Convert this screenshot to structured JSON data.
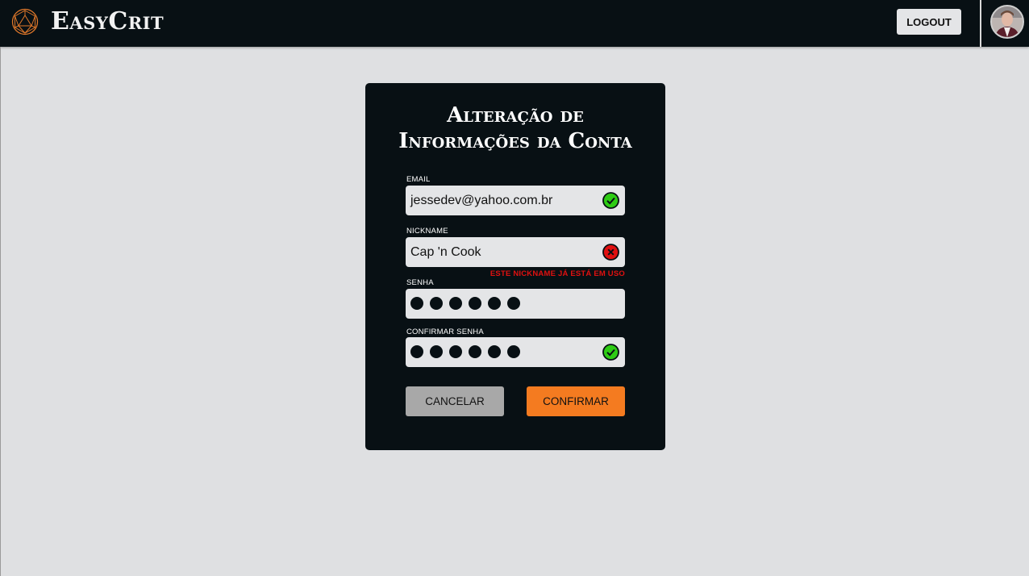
{
  "header": {
    "brand": "EasyCrit",
    "logout_label": "LOGOUT",
    "logo_icon": "d20-icon",
    "avatar_icon": "user-avatar"
  },
  "form": {
    "title_line1": "Alteração de",
    "title_line2": "Informações da Conta",
    "email": {
      "label": "EMAIL",
      "value": "jessedev@yahoo.com.br",
      "status": "valid"
    },
    "nickname": {
      "label": "NICKNAME",
      "value": "Cap 'n Cook",
      "status": "invalid",
      "error": "ESTE NICKNAME JÁ ESTÁ EM USO"
    },
    "password": {
      "label": "SENHA",
      "masked_length": 6
    },
    "confirm_password": {
      "label": "CONFIRMAR SENHA",
      "masked_length": 6,
      "status": "valid"
    },
    "cancel_label": "CANCELAR",
    "confirm_label": "CONFIRMAR"
  },
  "colors": {
    "background": "#dfe0e2",
    "dark": "#081014",
    "accent": "#f47b20",
    "valid": "#2ecc14",
    "invalid": "#e01010"
  }
}
